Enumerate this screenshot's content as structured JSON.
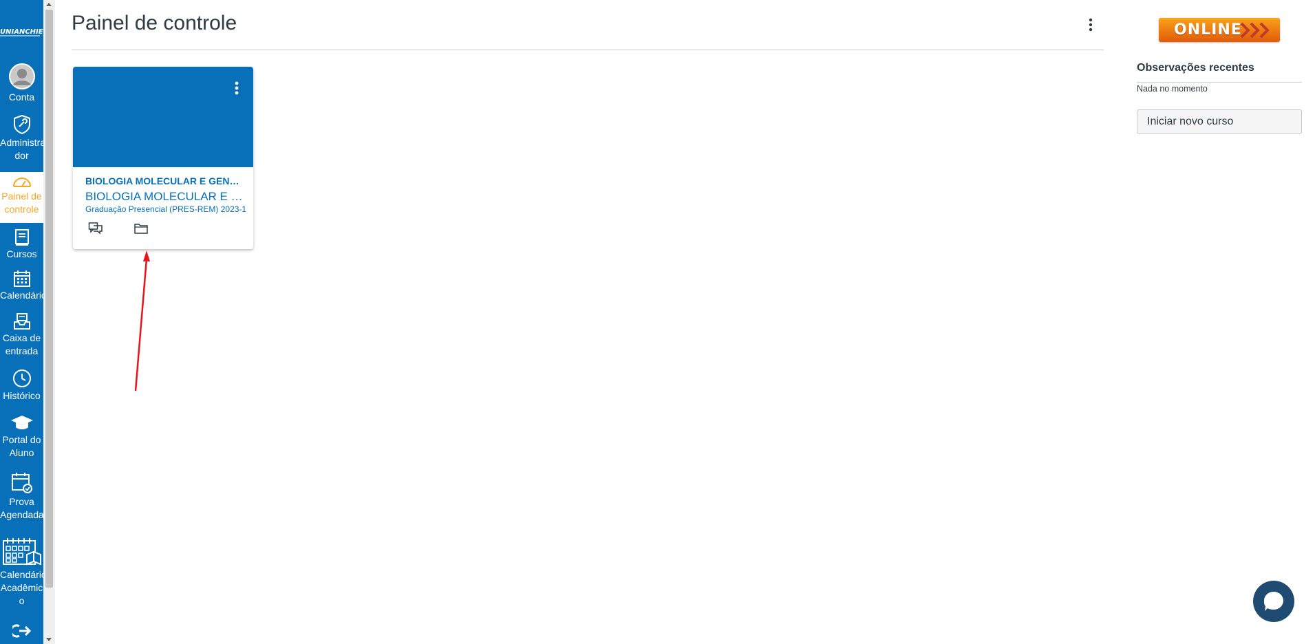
{
  "global_nav": {
    "logo_text": "UNIANCHIETA",
    "items": [
      {
        "label": "Conta",
        "icon": "account-avatar-icon"
      },
      {
        "label": "Administrador",
        "label_lines": [
          "Administra",
          "dor"
        ],
        "icon": "shield-admin-icon"
      },
      {
        "label": "Painel de controle",
        "label_lines": [
          "Painel de",
          "controle"
        ],
        "icon": "dashboard-gauge-icon",
        "active": true
      },
      {
        "label": "Cursos",
        "icon": "courses-book-icon"
      },
      {
        "label": "Calendário",
        "icon": "calendar-icon"
      },
      {
        "label": "Caixa de entrada",
        "label_lines": [
          "Caixa de",
          "entrada"
        ],
        "icon": "inbox-icon"
      },
      {
        "label": "Histórico",
        "icon": "clock-history-icon"
      },
      {
        "label": "Portal do Aluno",
        "label_lines": [
          "Portal do",
          "Aluno"
        ],
        "icon": "graduation-cap-icon"
      },
      {
        "label": "Prova Agendada",
        "label_lines": [
          "Prova",
          "Agendada"
        ],
        "icon": "calendar-check-icon"
      },
      {
        "label": "Calendário Acadêmico",
        "label_lines": [
          "Calendário",
          "Acadêmic",
          "o"
        ],
        "icon": "academic-calendar-icon"
      },
      {
        "label": "",
        "icon": "logout-arrow-icon"
      }
    ]
  },
  "header": {
    "title": "Painel de controle",
    "options_icon": "kebab-menu-icon"
  },
  "course_card": {
    "short_name": "BIOLOGIA MOLECULAR E GENÉ...",
    "long_name": "BIOLOGIA MOLECULAR E GE...",
    "term": "Graduação Presencial (PRES-REM) 2023-1",
    "hero_color": "#0770b8",
    "options_icon": "kebab-menu-icon",
    "action_icons": [
      "discussions-icon",
      "files-folder-icon"
    ]
  },
  "sidebar": {
    "badge_text": "ONLINE",
    "recent_title": "Observações recentes",
    "recent_empty": "Nada no momento",
    "start_course_label": "Iniciar novo curso"
  },
  "colors": {
    "brand": "#0770b8",
    "active_nav_text": "#f5a623",
    "annotation_arrow": "#e8141b",
    "chat_button": "#1f4a71"
  }
}
